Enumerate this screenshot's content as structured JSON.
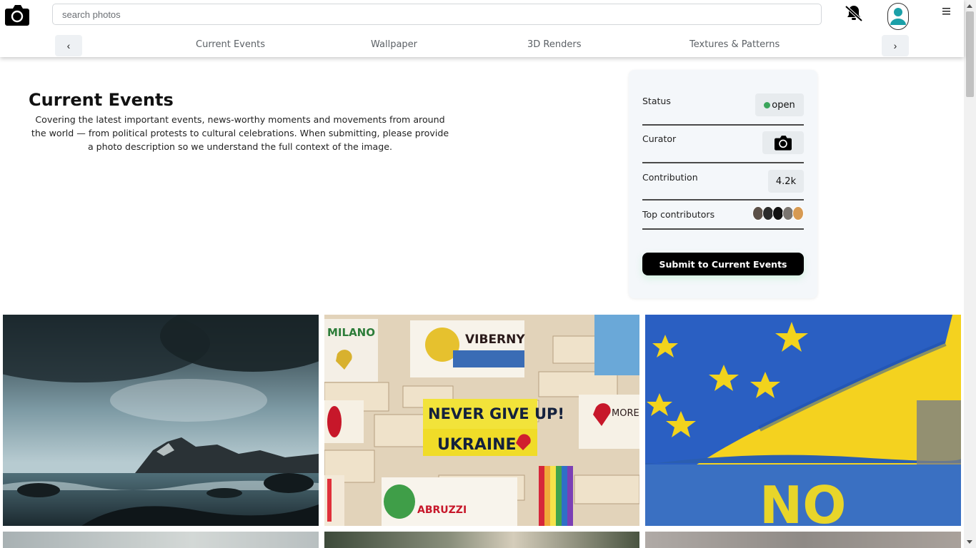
{
  "header": {
    "search_placeholder": "search photos",
    "logo_icon": "camera-icon",
    "notifications_icon": "bell-off-icon",
    "avatar_icon": "user-avatar-icon",
    "menu_icon": "hamburger-menu-icon",
    "prev_label": "‹",
    "next_label": "›",
    "categories": [
      "Current Events",
      "Wallpaper",
      "3D Renders",
      "Textures & Patterns"
    ]
  },
  "topic": {
    "title": "Current Events",
    "description": "Covering the latest important events, news-worthy moments and movements from around the world — from political protests to cultural celebrations. When submitting, please provide a photo description so we understand the full context of the image."
  },
  "info": {
    "status_label": "Status",
    "status_value": "open",
    "status_color": "#3ba55c",
    "curator_label": "Curator",
    "curator_icon": "camera-icon",
    "contribution_label": "Contribution",
    "contribution_value": "4.2k",
    "top_contributors_label": "Top contributors",
    "submit_label": "Submit to Current Events"
  },
  "photos": [
    {
      "subject": "stormy coastline with mountains"
    },
    {
      "subject": "painted wooden blocks with slogan"
    },
    {
      "subject": "EU and Ukraine flags at protest"
    }
  ],
  "photo_texts": {
    "block_main_1": "NEVER GIVE UP!",
    "block_main_2": "UKRAINE",
    "block_top_left": "MILANO",
    "block_top_middle": "VIBERNY",
    "block_right": "MORE LOVE",
    "block_bottom": "ABRUZZI",
    "flag_sign": "NO"
  }
}
